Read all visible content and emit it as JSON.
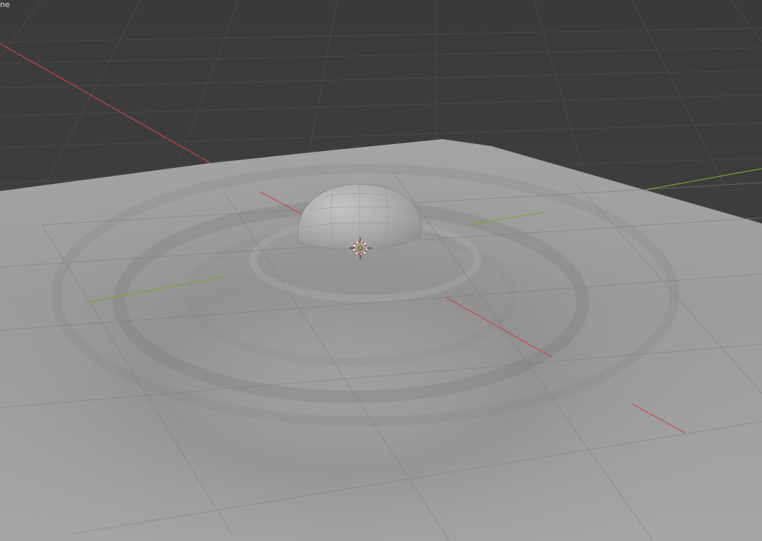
{
  "viewport": {
    "overlay_text": "ne",
    "background_color": "#3d3d3d",
    "grid_color": "#4a4a4a",
    "x_axis_color": "#c84646",
    "y_axis_color": "#7aa23c",
    "plane_color": "#9d9d9d",
    "dome_color": "#a5a5a5"
  },
  "scene": {
    "objects": [
      "plane",
      "dome",
      "3d-cursor"
    ]
  }
}
